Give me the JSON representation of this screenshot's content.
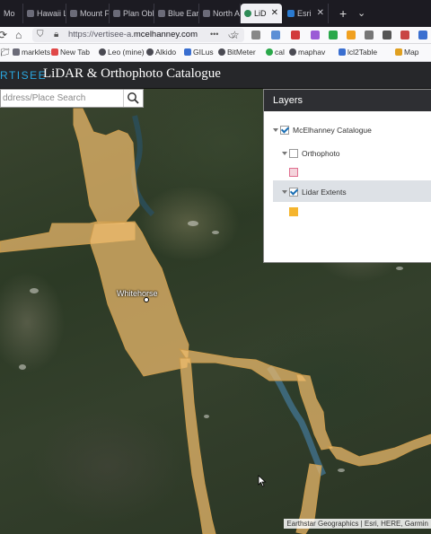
{
  "browser": {
    "tabs": [
      {
        "label": "Mo",
        "active": false
      },
      {
        "label": "Hawaii Lo",
        "active": false
      },
      {
        "label": "Mount F",
        "active": false
      },
      {
        "label": "Plan Obli",
        "active": false
      },
      {
        "label": "Blue Earth",
        "active": false
      },
      {
        "label": "North Am",
        "active": false
      },
      {
        "label": "LiD",
        "active": true
      },
      {
        "label": "Esri",
        "active": false
      }
    ],
    "url_prefix": "https://vertisee-a.",
    "url_domain": "mcelhanney.com",
    "bookmarks": [
      {
        "label": "marklets",
        "color": "#6b6b78"
      },
      {
        "label": "New Tab",
        "color": "#e04848"
      },
      {
        "label": "Leo (mine)",
        "color": "#4a4a52"
      },
      {
        "label": "Alkido",
        "color": "#4a4a52"
      },
      {
        "label": "GILus",
        "color": "#3a6fd0"
      },
      {
        "label": "BitMeter",
        "color": "#4a4a52"
      },
      {
        "label": "cal",
        "color": "#2aa84a"
      },
      {
        "label": "maphav",
        "color": "#4a4a52"
      },
      {
        "label": "lcl2Table",
        "color": "#3a6fd0"
      },
      {
        "label": "Map",
        "color": "#e0a020"
      }
    ]
  },
  "app": {
    "brand": "RTISEE",
    "title": "LiDAR & Orthophoto Catalogue"
  },
  "search": {
    "placeholder": "ddress/Place Search"
  },
  "map": {
    "city_label": "Whitehorse",
    "attribution": "Earthstar Geographics | Esri, HERE, Garmin",
    "extent_color": "#f0bc6e"
  },
  "layers": {
    "title": "Layers",
    "group": {
      "label": "McElhanney Catalogue",
      "checked": true
    },
    "items": [
      {
        "label": "Orthophoto",
        "checked": false,
        "swatch_color": "#f4d4dc",
        "swatch_border": "#e07090"
      },
      {
        "label": "Lidar Extents",
        "checked": true,
        "swatch_color": "#f5b52e",
        "swatch_border": "#f5b52e"
      }
    ]
  }
}
